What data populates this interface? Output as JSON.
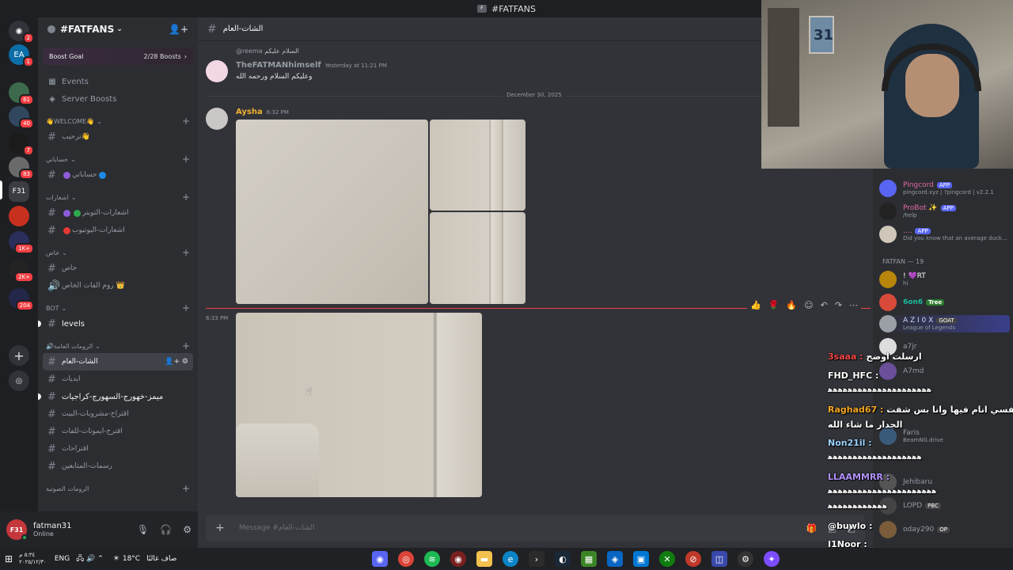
{
  "window": {
    "title": "#FATFANS"
  },
  "servers": [
    {
      "badge": "2"
    },
    {
      "badge": "1"
    },
    {
      "badge": "61"
    },
    {
      "badge": "40"
    },
    {
      "badge": "7"
    },
    {
      "badge": "83"
    },
    {
      "badge": ""
    },
    {
      "badge": ""
    },
    {
      "badge": "1K+"
    },
    {
      "badge": "2K+"
    },
    {
      "badge": "204"
    }
  ],
  "guild": {
    "name": "#FATFANS",
    "boost_goal": "Boost Goal",
    "boost_count": "2/28 Boosts"
  },
  "nav": {
    "events": "Events",
    "server_boosts": "Server Boosts"
  },
  "categories": {
    "welcome": "👋WELCOME👋",
    "c2": "حساباتي",
    "c3": "اشعارات",
    "c4": "خاص",
    "bot": "BOT",
    "c6": "🔊الرومات العامة",
    "c7": "الرومات الصوتية"
  },
  "channels": {
    "welcome": "ترحيب👋",
    "accounts": "حساباتي",
    "notif_twitch": "اشعارات-التويتر",
    "notif_youtube": "اشعارات-اليوتيوب",
    "private": "خاص",
    "private_room": "روم الفات الخاص 👑",
    "levels": "levels",
    "general": "الشات-العام",
    "ideas": "ايديات",
    "memes": "ميمز-خهورج-السهورج-كراجيات",
    "suggest_drinks": "اقتراح-مشروبات-البيت",
    "suggest_emotes": "اقترح-ايموتات-للفات",
    "suggestions": "اقتراحات",
    "drawings": "رسمات-المتابعين"
  },
  "user": {
    "name": "fatman31",
    "status": "Online"
  },
  "chat": {
    "channel_name": "الشات-العام",
    "reply_mention": "@reema",
    "reply_text": "السلام عليكم",
    "msg1_author": "TheFATMANhimself",
    "msg1_time": "Yesterday at 11:21 PM",
    "msg1_text": "وعليكم السلام ورحمه الله",
    "date_divider": "December 30, 2025",
    "msg2_author": "Aysha",
    "msg2_time": "6:32 PM",
    "msg3_time": "6:33 PM",
    "composer_placeholder": "Message #الشات-العام"
  },
  "members": {
    "bots": [
      {
        "name": "Pingcord",
        "tag": "APP",
        "sub": "pingcord.xyz | ?pingcord | v2.2.1"
      },
      {
        "name": "ProBot ✨",
        "tag": "APP",
        "sub": "/help"
      },
      {
        "name": "....",
        "tag": "APP",
        "sub": "Did you know that an average duck..."
      }
    ],
    "group_header": "FATFAN — 19",
    "list": [
      {
        "name": "! 💜RT",
        "sub": "hi"
      },
      {
        "name": "6on6",
        "sub": "Tree"
      },
      {
        "name": "A Z I 0 X",
        "sub": "League of Legends",
        "tag": "GOAT"
      },
      {
        "name": "a7jr",
        "sub": ""
      },
      {
        "name": "A7md",
        "sub": ""
      },
      {
        "name": "Faris",
        "sub": "BeamNG.drive"
      },
      {
        "name": "Jehibaru",
        "sub": ""
      },
      {
        "name": "LOPD",
        "sub": "PBC"
      },
      {
        "name": "oday290",
        "sub": "OP"
      }
    ]
  },
  "overlay_chat": [
    {
      "user": "3saaa :",
      "text": "ارسلت اوضح",
      "color": "#f04747"
    },
    {
      "user": "FHD_HFC :",
      "text": "",
      "color": "#ffffff"
    },
    {
      "user": "",
      "text": "ﻫﻫﻫﻫﻫﻫﻫﻫﻫﻫﻫﻫﻫﻫﻫﻫﻫﻫﻫﻫﻫ",
      "color": "#ffffff"
    },
    {
      "user": "Raghad67 :",
      "text": "نفسي انام فيها وانا بس شفت",
      "color": "#f5a623"
    },
    {
      "user": "",
      "text": "الجدار ما شاء الله",
      "color": "#ffffff"
    },
    {
      "user": "Non21il :",
      "text": "",
      "color": "#9ad3ff"
    },
    {
      "user": "",
      "text": "ﻫﻫﻫﻫﻫﻫﻫﻫﻫﻫﻫﻫﻫﻫﻫﻫﻫﻫﻫ",
      "color": "#ffffff"
    },
    {
      "user": "LLAAMMRR :",
      "text": "",
      "color": "#b392ff"
    },
    {
      "user": "",
      "text": "ﻫﻫﻫﻫﻫﻫﻫﻫﻫﻫﻫﻫﻫﻫﻫﻫﻫﻫﻫﻫﻫﻫ",
      "color": "#ffffff"
    },
    {
      "user": "",
      "text": "ﻫﻫﻫﻫﻫﻫﻫﻫﻫﻫﻫﻫ",
      "color": "#ffffff"
    },
    {
      "user": "@buwlo :",
      "text": "",
      "color": "#ffffff"
    },
    {
      "user": "I1Noor :",
      "text": "",
      "color": "#ffffff"
    }
  ],
  "taskbar": {
    "time": "٥:٣٤ م",
    "date": "٢٠٢٥/١٢/٣٠",
    "lang": "ENG",
    "weather_temp": "18°C",
    "weather_text": "صاف غالبًا"
  }
}
